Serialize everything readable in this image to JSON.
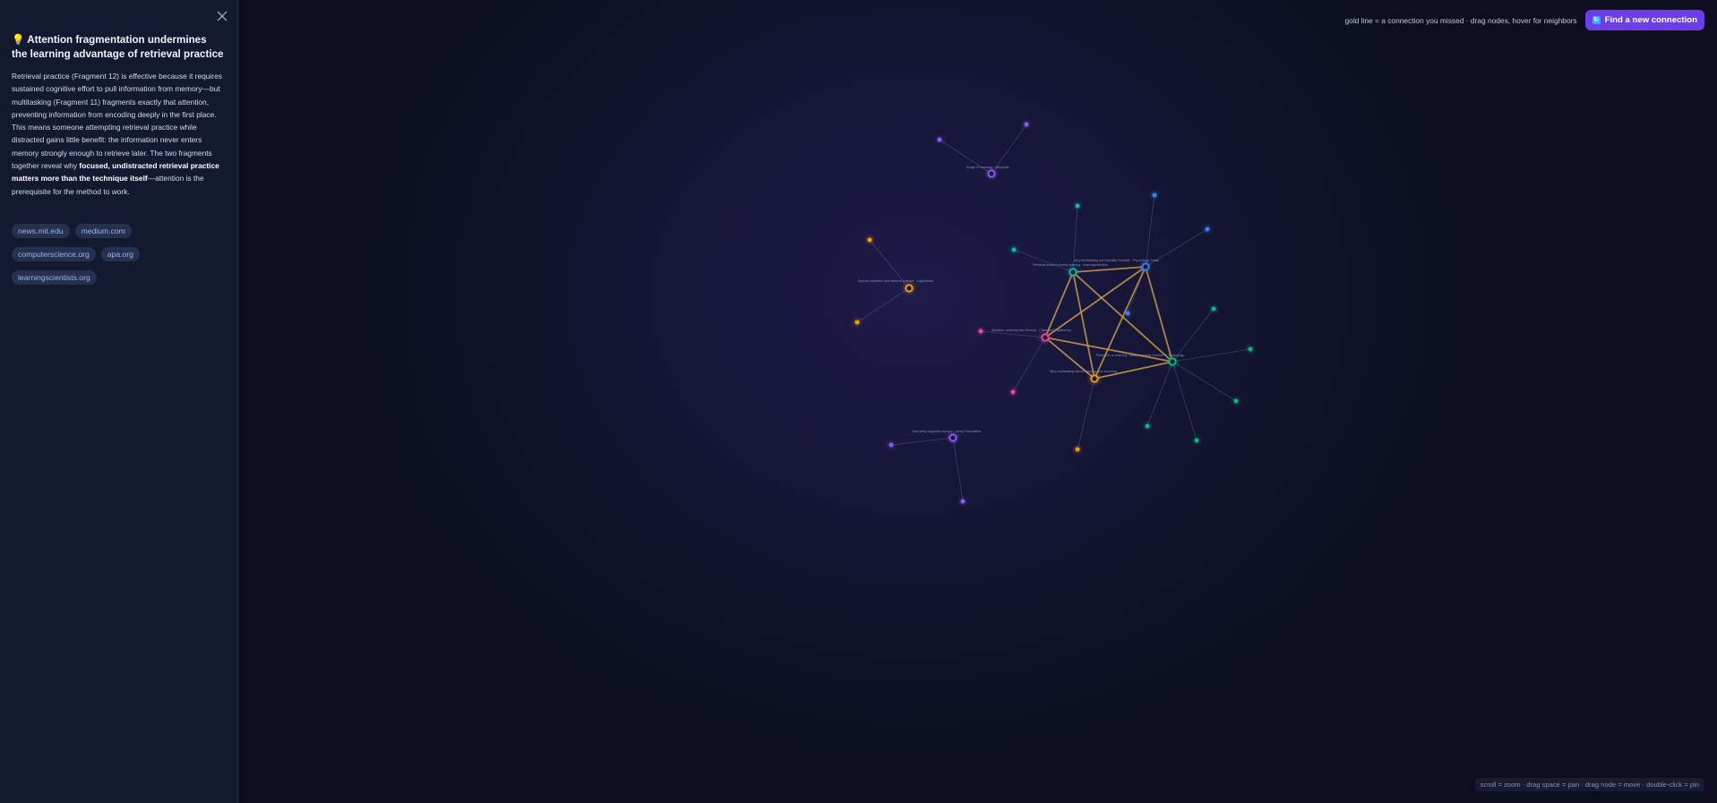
{
  "sidebar": {
    "close_icon": "close-icon",
    "insight_icon": "lightbulb-icon",
    "insight_emoji": "💡",
    "title_line1": "Attention fragmentation undermines",
    "title_line2": "the learning advantage of retrieval practice",
    "body_1": "Retrieval practice (Fragment 12) is effective because it requires sustained cognitive effort to pull information from memory—but multitasking (Fragment 11) fragments exactly that attention, preventing information from encoding deeply in the first place. This means someone attempting retrieval practice while distracted gains little benefit: the information never enters memory strongly enough to retrieve later. The two fragments together reveal why ",
    "body_bold": "focused, undistracted retrieval practice matters more than the technique itself",
    "body_2": "—attention is the prerequisite for the method to work.",
    "tags": [
      "news.mit.edu",
      "medium.com",
      "computerscience.org",
      "apa.org",
      "learningscientists.org"
    ]
  },
  "topbar": {
    "hint": "gold line = a connection you missed · drag nodes, hover for neighbors",
    "find_button": "Find a new connection",
    "find_icon": "refresh-icon"
  },
  "footer_hint": "scroll = zoom · drag space = pan · drag node = move · double-click = pin",
  "colors": {
    "purple": "#8b5cf6",
    "blue": "#3b82f6",
    "teal": "#14b8a6",
    "green": "#10b981",
    "pink": "#ec4899",
    "orange": "#f59e0b",
    "gold_line": "#d4a24a",
    "accent": "#6d3ee8"
  },
  "graph": {
    "hubs": [
      {
        "id": "h-purple-top",
        "color": "purple",
        "label": "Image Processing · Wikipedia"
      },
      {
        "id": "h-orange-left",
        "color": "orange",
        "label": "Spaced repetition and retrieval practice · LogicMemo"
      },
      {
        "id": "h-teal",
        "color": "teal",
        "label": "Retrieval practice boosts learning · learningscientists"
      },
      {
        "id": "h-blue",
        "color": "blue",
        "label": "Why Multitasking Isn't Actually Possible · Psychology Today"
      },
      {
        "id": "h-pink",
        "color": "pink",
        "label": "Attention, learning and Memory · Collegeof Engineering"
      },
      {
        "id": "h-green",
        "color": "green",
        "label": "Research on learning · Massachusetts Institute of Technology"
      },
      {
        "id": "h-orange-center",
        "color": "orange",
        "label": "Why multitasking harms memory and encoding"
      },
      {
        "id": "h-purple-bottom",
        "color": "purple",
        "label": "How sleep supports memory · Sleep Foundation"
      }
    ],
    "gold_connections": 10
  }
}
